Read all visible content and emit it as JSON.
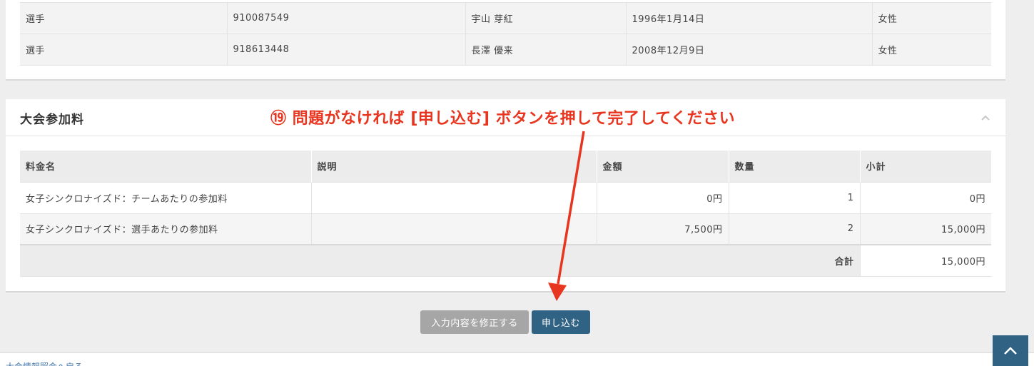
{
  "players": {
    "rows": [
      {
        "role": "選手",
        "id": "910087549",
        "name": "宇山 芽紅",
        "birthday": "1996年1月14日",
        "gender": "女性"
      },
      {
        "role": "選手",
        "id": "918613448",
        "name": "長澤 優来",
        "birthday": "2008年12月9日",
        "gender": "女性"
      }
    ]
  },
  "fees": {
    "title": "大会参加料",
    "headers": {
      "name": "料金名",
      "desc": "説明",
      "amount": "金額",
      "qty": "数量",
      "subtotal": "小計"
    },
    "rows": [
      {
        "name": "女子シンクロナイズド：チームあたりの参加料",
        "desc": "",
        "amount": "0円",
        "qty": "1",
        "subtotal": "0円"
      },
      {
        "name": "女子シンクロナイズド：選手あたりの参加料",
        "desc": "",
        "amount": "7,500円",
        "qty": "2",
        "subtotal": "15,000円"
      }
    ],
    "total_label": "合計",
    "total_value": "15,000円"
  },
  "annotation": {
    "text": "⑲ 問題がなければ [申し込む] ボタンを押して完了してください",
    "color": "#e8351f"
  },
  "buttons": {
    "edit_label": "入力内容を修正する",
    "submit_label": "申し込む"
  },
  "footer": {
    "link_text": "大会情報照会へ戻る"
  },
  "icons": {
    "collapse": "chevron-up-icon",
    "scroll_top": "chevron-up-icon"
  },
  "colors": {
    "primary": "#2f6283",
    "secondary_button": "#a6a6a6",
    "annotation": "#e8351f"
  }
}
